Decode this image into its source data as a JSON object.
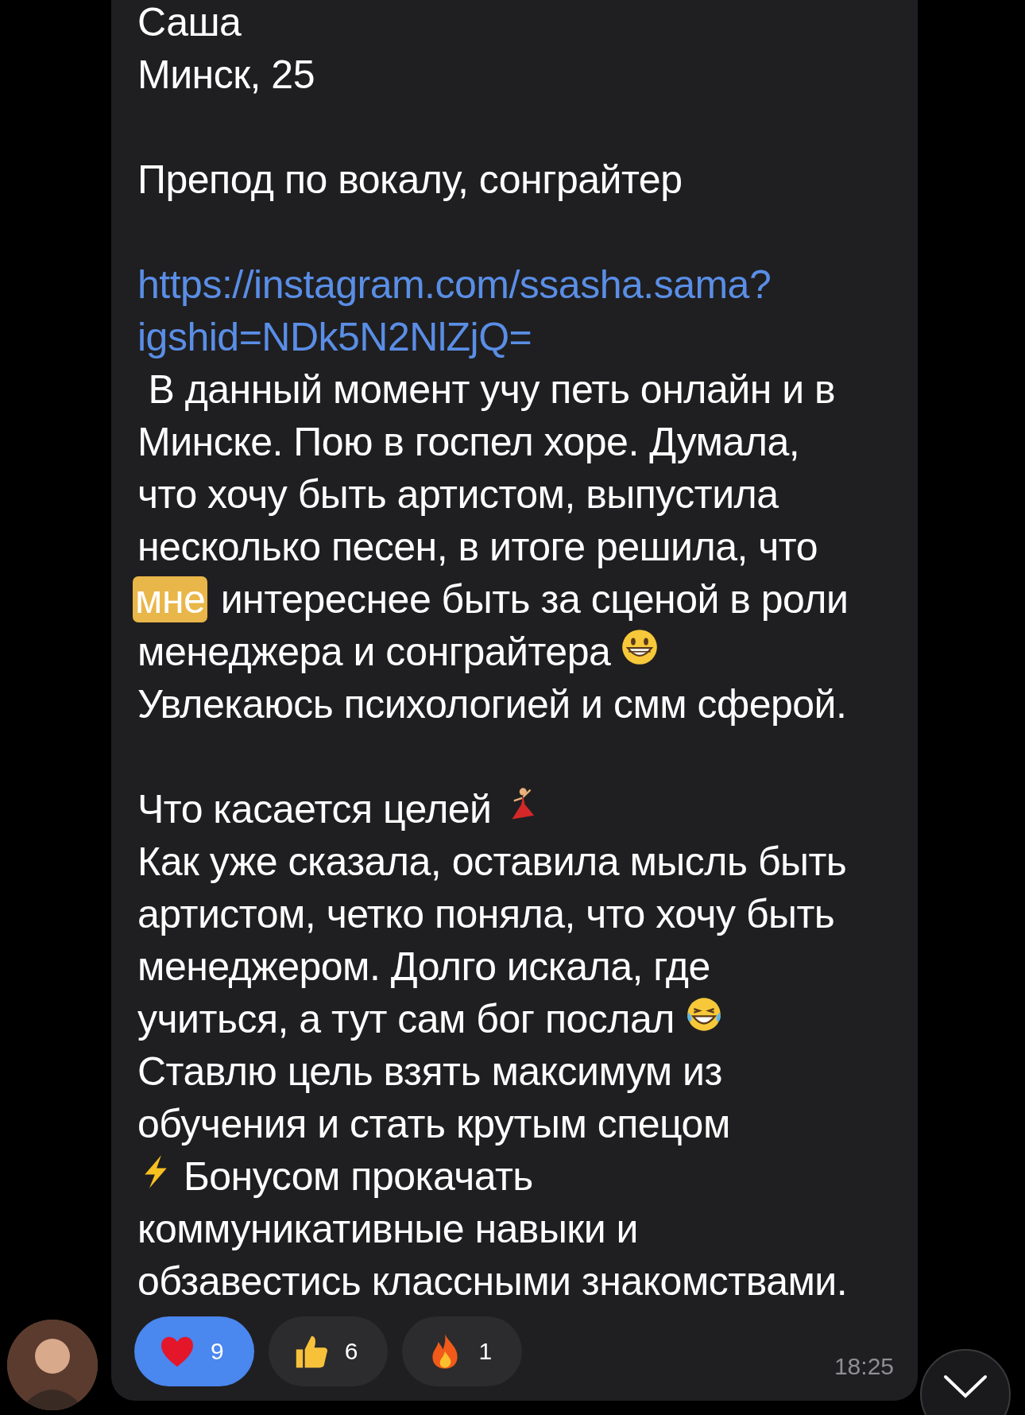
{
  "message": {
    "paragraphs": [
      {
        "lines": [
          {
            "kind": "text",
            "text": "Саша"
          },
          {
            "kind": "text",
            "text": "Минск, 25"
          }
        ]
      },
      {
        "lines": [
          {
            "kind": "text",
            "text": "Препод по вокалу, сонграйтер"
          }
        ]
      },
      {
        "lines": [
          {
            "kind": "link",
            "text": "https://instagram.com/ssasha.sama?"
          },
          {
            "kind": "link",
            "text": "igshid=NDk5N2NlZjQ="
          },
          {
            "kind": "text",
            "text": " В данный момент учу петь онлайн и в"
          },
          {
            "kind": "text",
            "text": "Минске. Пою в госпел хоре. Думала,"
          },
          {
            "kind": "text",
            "text": "что хочу быть артистом, выпустила"
          },
          {
            "kind": "text",
            "text": "несколько песен, в итоге решила, что"
          },
          {
            "kind": "highlight",
            "highlighted": "мне",
            "text": " интереснее быть за сценой в роли"
          },
          {
            "kind": "grin_end",
            "text": "менеджера и сонграйтера"
          },
          {
            "kind": "text",
            "text": "Увлекаюсь психологией и смм сферой."
          }
        ]
      },
      {
        "lines": [
          {
            "kind": "dancer_end",
            "text": "Что касается целей"
          },
          {
            "kind": "text",
            "text": "Как уже сказала, оставила мысль быть"
          },
          {
            "kind": "text",
            "text": "артистом, четко поняла, что хочу быть"
          },
          {
            "kind": "text",
            "text": "менеджером. Долго искала, где"
          },
          {
            "kind": "laugh_end",
            "text": "учиться, а тут сам бог послал"
          },
          {
            "kind": "text",
            "text": "Ставлю цель взять максимум из"
          },
          {
            "kind": "text",
            "text": "обучения и стать крутым спецом"
          },
          {
            "kind": "bolt_start",
            "text": "Бонусом прокачать"
          },
          {
            "kind": "text",
            "text": "коммуникативные навыки и"
          },
          {
            "kind": "text",
            "text": "обзавестись классными знакомствами."
          }
        ]
      }
    ],
    "reactions": [
      {
        "kind": "heart",
        "count": "9",
        "selected": true
      },
      {
        "kind": "thumbs",
        "count": "6",
        "selected": false
      },
      {
        "kind": "fire",
        "count": "1",
        "selected": false
      }
    ],
    "time": "18:25"
  }
}
